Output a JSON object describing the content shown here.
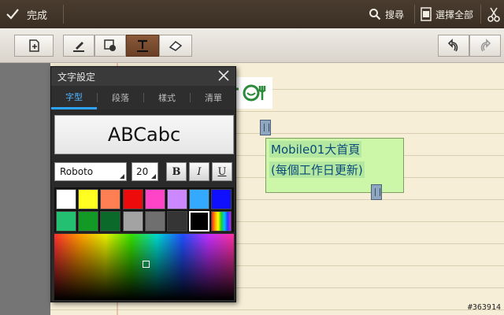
{
  "topbar": {
    "done_label": "完成",
    "search_label": "搜尋",
    "select_all_label": "選擇全部"
  },
  "note": {
    "text_lines": [
      "Mobile01大首頁",
      "(每個工作日更新)"
    ]
  },
  "text_settings_panel": {
    "title": "文字設定",
    "tabs": [
      "字型",
      "段落",
      "樣式",
      "清單"
    ],
    "selected_tab": "字型",
    "preview_text": "ABCabc",
    "font_family_value": "Roboto",
    "font_size_value": "20",
    "bold_label": "B",
    "italic_label": "I",
    "underline_label": "U",
    "palette_row1": [
      "#ffffff",
      "#ffff22",
      "#ff7f55",
      "#ee0b0b",
      "#ff44c8",
      "#cc88ff",
      "#33aaff",
      "#1010ff"
    ],
    "palette_row2": [
      "#22c070",
      "#129926",
      "#0b6a2a",
      "#a3a3a3",
      "#6f6f6f",
      "#353535",
      "#000000",
      "spectrum-swatch"
    ],
    "selected_color": "#000000"
  },
  "watermark": "#363914",
  "colors": {
    "topbar_bg": "#3f3228",
    "accent_tab": "#2ea3ff",
    "note_box_bg": "#ccf6a8",
    "note_text": "#0a4a7a"
  }
}
